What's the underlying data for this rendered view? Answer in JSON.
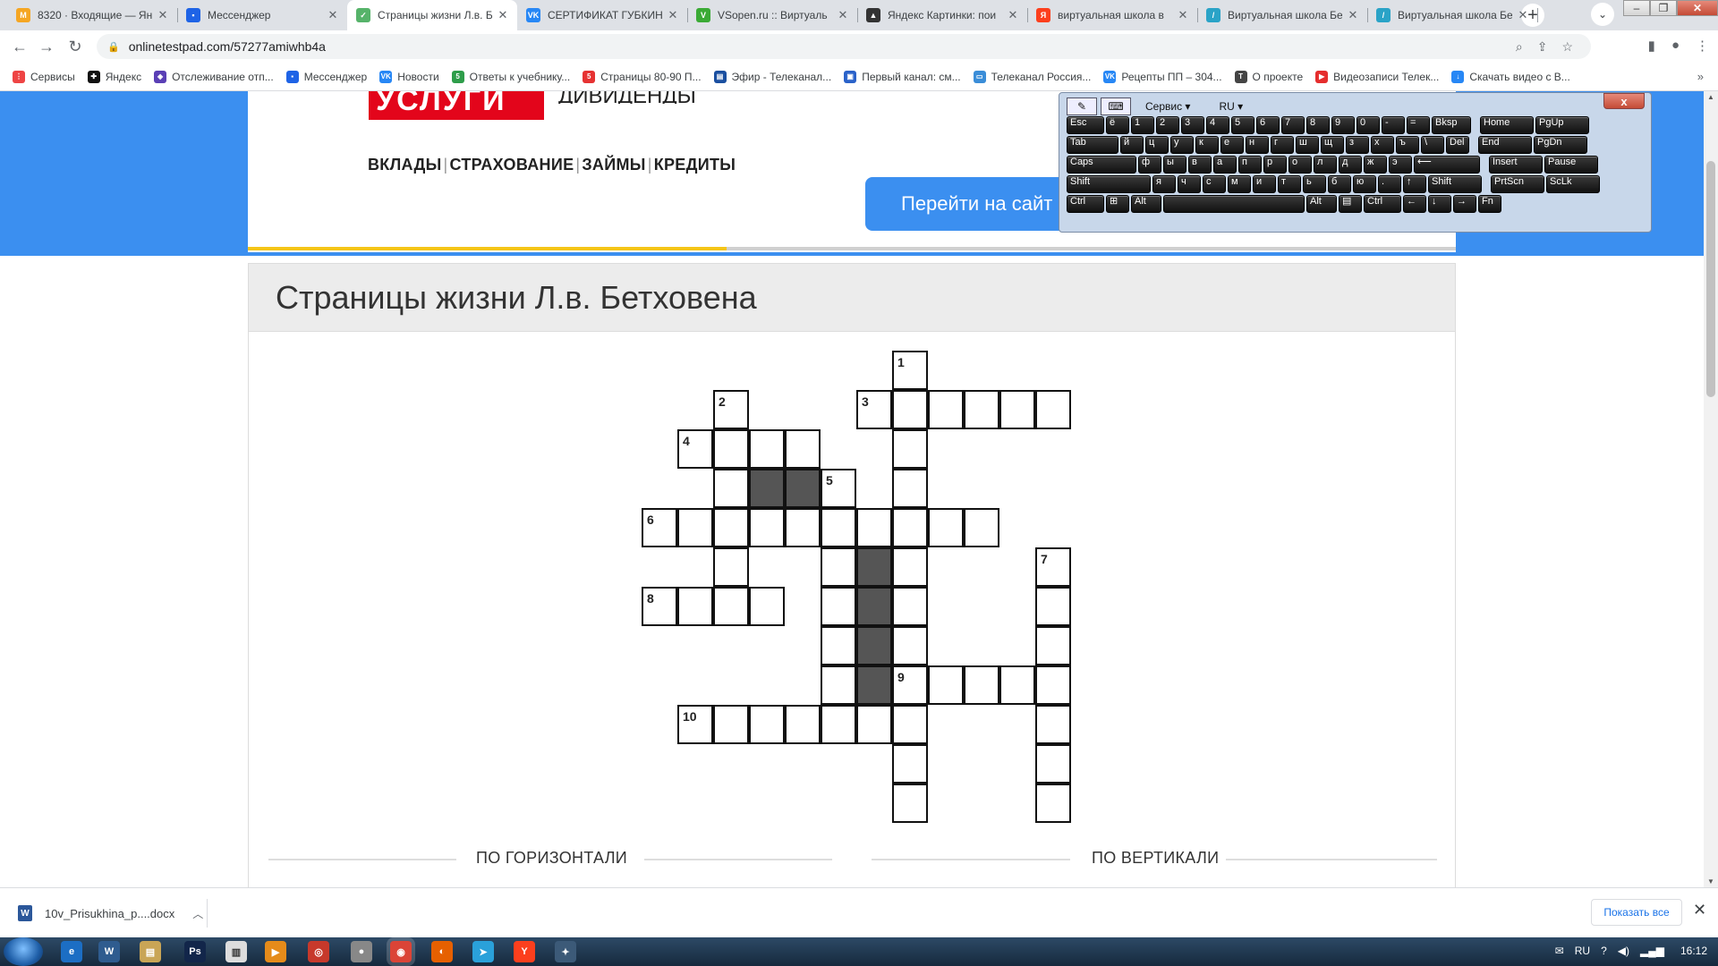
{
  "browser": {
    "tabs": [
      {
        "title": "8320 · Входящие — Ян",
        "color": "#f5a623",
        "mark": "М"
      },
      {
        "title": "Мессенджер",
        "color": "#1e63e6",
        "mark": "▪"
      },
      {
        "title": "Страницы жизни Л.в. Б",
        "color": "#56b36a",
        "mark": "✓",
        "active": true
      },
      {
        "title": "СЕРТИФИКАТ ГУБКИН",
        "color": "#2787f5",
        "mark": "VK"
      },
      {
        "title": "VSopen.ru :: Виртуаль",
        "color": "#3aaa35",
        "mark": "V"
      },
      {
        "title": "Яндекс Картинки: пои",
        "color": "#333333",
        "mark": "▲"
      },
      {
        "title": "виртуальная школа в",
        "color": "#fc3f1d",
        "mark": "Я"
      },
      {
        "title": "Виртуальная школа Бе",
        "color": "#2aa3c7",
        "mark": "/"
      },
      {
        "title": "Виртуальная школа Бе",
        "color": "#2aa3c7",
        "mark": "/"
      }
    ],
    "new_tab_label": "+",
    "url": "onlinetestpad.com/57277amiwhb4a",
    "bookmarks": [
      {
        "label": "Сервисы",
        "color": "#e44",
        "mark": "⋮"
      },
      {
        "label": "Яндекс",
        "color": "#111",
        "mark": "✚"
      },
      {
        "label": "Отслеживание отп...",
        "color": "#5a3fb5",
        "mark": "◈"
      },
      {
        "label": "Мессенджер",
        "color": "#1e63e6",
        "mark": "▪"
      },
      {
        "label": "Новости",
        "color": "#2787f5",
        "mark": "VK"
      },
      {
        "label": "Ответы к учебнику...",
        "color": "#2e9d4a",
        "mark": "5"
      },
      {
        "label": "Страницы 80-90 П...",
        "color": "#e63232",
        "mark": "5"
      },
      {
        "label": "Эфир - Телеканал...",
        "color": "#1a4fa0",
        "mark": "▤"
      },
      {
        "label": "Первый канал: см...",
        "color": "#2a62c9",
        "mark": "▣"
      },
      {
        "label": "Телеканал Россия...",
        "color": "#3a8dd8",
        "mark": "▭"
      },
      {
        "label": "Рецепты ПП – 304...",
        "color": "#2787f5",
        "mark": "VK"
      },
      {
        "label": "О проекте",
        "color": "#444",
        "mark": "T"
      },
      {
        "label": "Видеозаписи Телек...",
        "color": "#e52d2d",
        "mark": "▶"
      },
      {
        "label": "Скачать видео с В...",
        "color": "#2787f5",
        "mark": "↓"
      }
    ]
  },
  "ad": {
    "brand_word": "УСЛУГИ",
    "dividend_word": "ДИВИДЕНДЫ",
    "services": [
      "ВКЛАДЫ",
      "СТРАХОВАНИЕ",
      "ЗАЙМЫ",
      "КРЕДИТЫ"
    ],
    "button": "Перейти на сайт"
  },
  "test": {
    "title": "Страницы жизни Л.в. Бетховена",
    "across_heading": "ПО ГОРИЗОНТАЛИ",
    "down_heading": "ПО ВЕРТИКАЛИ",
    "numbers": [
      "1",
      "2",
      "3",
      "4",
      "5",
      "6",
      "7",
      "8",
      "9",
      "10"
    ]
  },
  "keyboard": {
    "service_menu": "Сервис",
    "lang_menu": "RU",
    "close": "x",
    "rows": [
      [
        "Esc",
        "ё",
        "1",
        "2",
        "3",
        "4",
        "5",
        "6",
        "7",
        "8",
        "9",
        "0",
        "-",
        "=",
        "Bksp",
        "Home",
        "PgUp"
      ],
      [
        "Tab",
        "й",
        "ц",
        "у",
        "к",
        "е",
        "н",
        "г",
        "ш",
        "щ",
        "з",
        "х",
        "ъ",
        "\\",
        "Del",
        "End",
        "PgDn"
      ],
      [
        "Caps",
        "ф",
        "ы",
        "в",
        "а",
        "п",
        "р",
        "о",
        "л",
        "д",
        "ж",
        "э",
        "⟵",
        "Insert",
        "Pause"
      ],
      [
        "Shift",
        "я",
        "ч",
        "с",
        "м",
        "и",
        "т",
        "ь",
        "б",
        "ю",
        ".",
        "↑",
        "Shift",
        "PrtScn",
        "ScLk"
      ],
      [
        "Ctrl",
        "⊞",
        "Alt",
        "",
        "Alt",
        "▤",
        "Ctrl",
        "←",
        "↓",
        "→",
        "Fn"
      ]
    ]
  },
  "download": {
    "file": "10v_Prisukhina_p....docx",
    "show_all": "Показать все"
  },
  "taskbar": {
    "lang": "RU",
    "time": "16:12"
  }
}
